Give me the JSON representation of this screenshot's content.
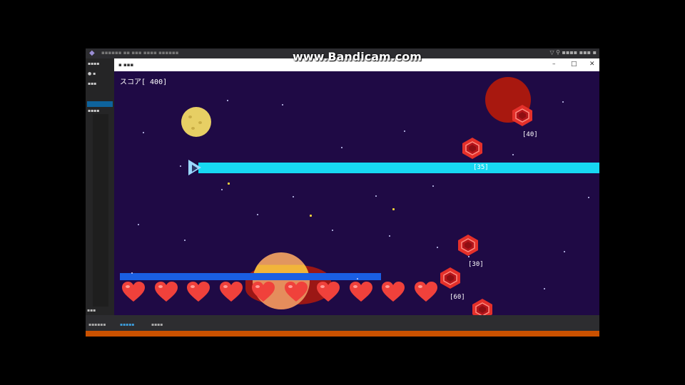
{
  "watermark": "www.Bandicam.com",
  "game": {
    "score_text": "スコア[ 400]",
    "hearts_count": 10,
    "hp_fraction": 1.0,
    "enemies": [
      {
        "label": "[40]"
      },
      {
        "label": "[35]"
      },
      {
        "label": "[30]"
      },
      {
        "label": "[60]"
      },
      {
        "label": ""
      }
    ]
  },
  "colors": {
    "background": "#1f0a45",
    "beam": "#17d8f2",
    "hp_bar": "#1a5fe3",
    "heart": "#f0413b",
    "enemy": "#e4302a"
  },
  "icons": [
    "vs-icon",
    "ship-icon",
    "heart-icon",
    "enemy-hexagon-icon",
    "minimize-icon",
    "maximize-icon",
    "close-icon"
  ]
}
